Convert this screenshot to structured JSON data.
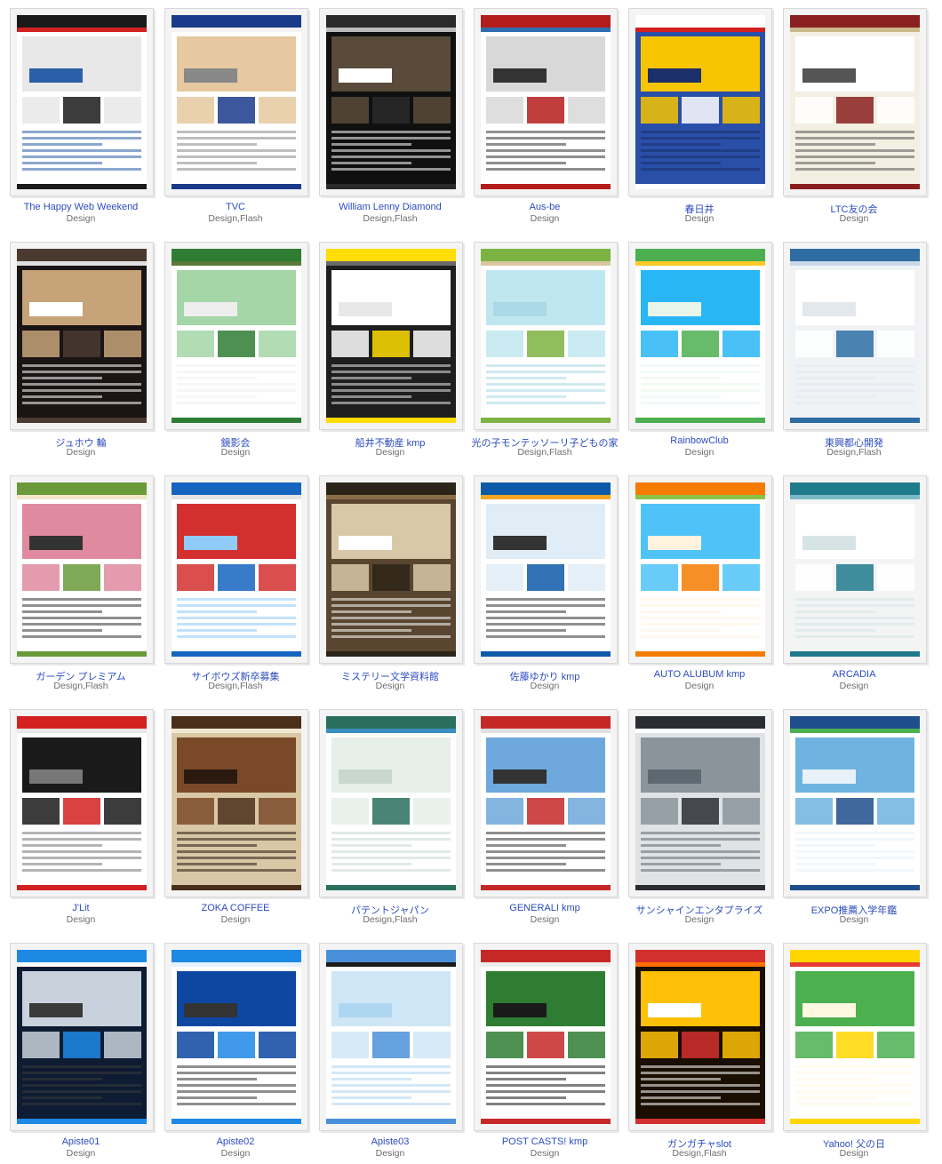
{
  "gallery": {
    "items": [
      {
        "title": "The Happy Web Weekend",
        "categories": "Design",
        "palette": [
          "#ffffff",
          "#1a1a1a",
          "#e8e8e8",
          "#d02020",
          "#2b5fa8"
        ]
      },
      {
        "title": "TVC",
        "categories": "Design,Flash",
        "palette": [
          "#ffffff",
          "#1a3a8a",
          "#e6c9a0",
          "#f2f2f2",
          "#888888"
        ]
      },
      {
        "title": "William Lenny Diamond",
        "categories": "Design,Flash",
        "palette": [
          "#101010",
          "#2a2a2a",
          "#5a4a3a",
          "#bbbbbb",
          "#ffffff"
        ]
      },
      {
        "title": "Aus-be",
        "categories": "Design",
        "palette": [
          "#ffffff",
          "#b51c1c",
          "#d8d8d8",
          "#2f6fb0",
          "#333333"
        ]
      },
      {
        "title": "春日井",
        "categories": "Design",
        "palette": [
          "#2a4fa8",
          "#ffffff",
          "#f6c400",
          "#d22020",
          "#1c2f6b"
        ]
      },
      {
        "title": "LTC友の会",
        "categories": "Design",
        "palette": [
          "#f3efe2",
          "#8a1f1f",
          "#ffffff",
          "#c9b98c",
          "#555555"
        ]
      },
      {
        "title": "ジュホウ 輪",
        "categories": "Design",
        "palette": [
          "#1b1414",
          "#4a3a30",
          "#c7a37a",
          "#e0e0e0",
          "#ffffff"
        ]
      },
      {
        "title": "鏡影会",
        "categories": "Design",
        "palette": [
          "#ffffff",
          "#2e7d32",
          "#a5d6a7",
          "#5b7a3a",
          "#eeeeee"
        ]
      },
      {
        "title": "船井不動産 kmp",
        "categories": "Design",
        "palette": [
          "#1e1e1e",
          "#ffdd00",
          "#ffffff",
          "#6a6a6a",
          "#e8e8e8"
        ]
      },
      {
        "title": "光の子モンテッソーリ子どもの家",
        "categories": "Design,Flash",
        "palette": [
          "#ffffff",
          "#7cb342",
          "#bfe7ef",
          "#d9c7a0",
          "#aad8e6"
        ]
      },
      {
        "title": "RainbowClub",
        "categories": "Design",
        "palette": [
          "#ffffff",
          "#4caf50",
          "#29b6f6",
          "#ffca28",
          "#e8f5e9"
        ]
      },
      {
        "title": "東興都心開発",
        "categories": "Design,Flash",
        "palette": [
          "#f0f3f6",
          "#2d6da3",
          "#ffffff",
          "#c9d8e6",
          "#e3e8ec"
        ]
      },
      {
        "title": "ガーデン プレミアム",
        "categories": "Design,Flash",
        "palette": [
          "#ffffff",
          "#6a9a3a",
          "#e08aa0",
          "#f2e6c8",
          "#333333"
        ]
      },
      {
        "title": "サイボウズ新卒募集",
        "categories": "Design,Flash",
        "palette": [
          "#ffffff",
          "#1565c0",
          "#d32f2f",
          "#e3e3e3",
          "#90caf9"
        ]
      },
      {
        "title": "ミステリー文学資料館",
        "categories": "Design",
        "palette": [
          "#5a4630",
          "#2b2418",
          "#d9c8a8",
          "#8a6d47",
          "#ffffff"
        ]
      },
      {
        "title": "佐藤ゆかり kmp",
        "categories": "Design",
        "palette": [
          "#ffffff",
          "#0d5aa7",
          "#e0ecf6",
          "#f5a623",
          "#333333"
        ]
      },
      {
        "title": "AUTO ALUBUM kmp",
        "categories": "Design",
        "palette": [
          "#ffffff",
          "#f57c00",
          "#4fc3f7",
          "#8bc34a",
          "#fff3e0"
        ]
      },
      {
        "title": "ARCADIA",
        "categories": "Design",
        "palette": [
          "#f3f5f5",
          "#1f7a8c",
          "#ffffff",
          "#7ab8c4",
          "#d6e4e6"
        ]
      },
      {
        "title": "J'Lit",
        "categories": "Design",
        "palette": [
          "#ffffff",
          "#d32020",
          "#1a1a1a",
          "#e8e8e8",
          "#777777"
        ]
      },
      {
        "title": "ZOKA COFFEE",
        "categories": "Design",
        "palette": [
          "#d9c8a6",
          "#4a2f1a",
          "#7a4a28",
          "#f2e8d2",
          "#2a1a10"
        ]
      },
      {
        "title": "パテントジャパン",
        "categories": "Design,Flash",
        "palette": [
          "#ffffff",
          "#2a6f5e",
          "#e6efe9",
          "#3a8fc0",
          "#c8d8d0"
        ]
      },
      {
        "title": "GENERALI kmp",
        "categories": "Design",
        "palette": [
          "#ffffff",
          "#c62828",
          "#6fa8dc",
          "#e0e0e0",
          "#333333"
        ]
      },
      {
        "title": "サンシャインエンタプライズ",
        "categories": "Design",
        "palette": [
          "#dfe3e6",
          "#2a2e33",
          "#8b939b",
          "#ffffff",
          "#5d6870"
        ]
      },
      {
        "title": "EXPO推薦入学年鑑",
        "categories": "Design",
        "palette": [
          "#ffffff",
          "#1e4e8c",
          "#6fb3e0",
          "#4caf50",
          "#e8f1f8"
        ]
      },
      {
        "title": "Apiste01",
        "categories": "Design",
        "palette": [
          "#0d1b33",
          "#1e88e5",
          "#c9d2dc",
          "#ffffff",
          "#3a3a3a"
        ]
      },
      {
        "title": "Apiste02",
        "categories": "Design",
        "palette": [
          "#ffffff",
          "#1e88e5",
          "#0d47a1",
          "#e3f2fd",
          "#333333"
        ]
      },
      {
        "title": "Apiste03",
        "categories": "Design",
        "palette": [
          "#ffffff",
          "#4a90d9",
          "#cfe6f7",
          "#1a1a1a",
          "#aed6f1"
        ]
      },
      {
        "title": "POST CASTS! kmp",
        "categories": "Design",
        "palette": [
          "#ffffff",
          "#c62828",
          "#2e7d32",
          "#eeeeee",
          "#1a1a1a"
        ]
      },
      {
        "title": "ガンガチャslot",
        "categories": "Design,Flash",
        "palette": [
          "#1a0e00",
          "#d32f2f",
          "#ffc107",
          "#ff6f00",
          "#ffffff"
        ]
      },
      {
        "title": "Yahoo! 父の日",
        "categories": "Design",
        "palette": [
          "#ffffff",
          "#ffd600",
          "#4caf50",
          "#e53935",
          "#fff8e1"
        ]
      }
    ]
  }
}
